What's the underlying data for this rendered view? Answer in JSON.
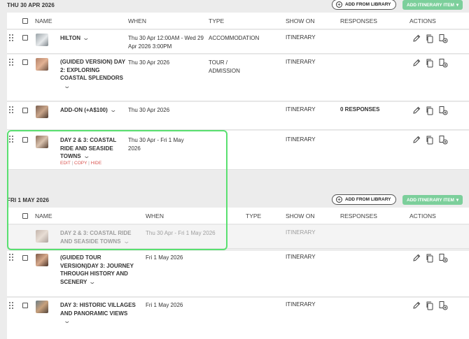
{
  "sections": [
    {
      "title": "THU 30 APR 2026",
      "library_label": "ADD FROM LIBRARY",
      "add_label": "ADD ITINERARY ITEM"
    },
    {
      "title": "FRI 1 MAY 2026",
      "library_label": "ADD FROM LIBRARY",
      "add_label": "ADD ITINERARY ITEM"
    }
  ],
  "columns": {
    "name": "NAME",
    "when": "WHEN",
    "type": "TYPE",
    "show_on": "SHOW ON",
    "responses": "RESPONSES",
    "actions": "ACTIONS"
  },
  "rows": [
    {
      "name": "HILTON",
      "when": "Thu 30 Apr 12:00AM - Wed 29 Apr 2026 3:00PM",
      "type": "ACCOMMODATION",
      "show_on": "ITINERARY",
      "responses": ""
    },
    {
      "name": "(GUIDED VERSION) DAY 2: EXPLORING COASTAL SPLENDORS",
      "when": "Thu 30 Apr 2026",
      "type": "TOUR / ADMISSION",
      "show_on": "ITINERARY",
      "responses": ""
    },
    {
      "name": "ADD-ON (+A$100)",
      "when": "Thu 30 Apr 2026",
      "type": "",
      "show_on": "ITINERARY",
      "responses": "0 RESPONSES"
    },
    {
      "name": "DAY 2 & 3: COASTAL RIDE AND SEASIDE TOWNS",
      "when": "Thu 30 Apr - Fri 1 May 2026",
      "type": "",
      "show_on": "ITINERARY",
      "responses": "",
      "links": {
        "edit": "EDIT",
        "copy": "COPY",
        "hide": "HIDE"
      }
    },
    {
      "name": "DAY 2 & 3: COASTAL RIDE AND SEASIDE TOWNS",
      "when": "Thu 30 Apr - Fri 1 May 2026",
      "type": "",
      "show_on": "ITINERARY",
      "responses": ""
    },
    {
      "name": "(GUIDED TOUR VERSION)DAY 3: JOURNEY THROUGH HISTORY AND SCENERY",
      "when": "Fri 1 May 2026",
      "type": "",
      "show_on": "ITINERARY",
      "responses": ""
    },
    {
      "name": "DAY 3: HISTORIC VILLAGES AND PANORAMIC VIEWS",
      "when": "Fri 1 May 2026",
      "type": "",
      "show_on": "ITINERARY",
      "responses": ""
    }
  ],
  "icons": {
    "drag": "drag-handle-icon",
    "edit": "pencil-icon",
    "copy": "copy-icon",
    "move": "move-day-icon",
    "chevron": "chevron-down-icon"
  },
  "colors": {
    "accent": "#7ccf9b",
    "highlight": "#59e070",
    "link": "#d9534f"
  }
}
